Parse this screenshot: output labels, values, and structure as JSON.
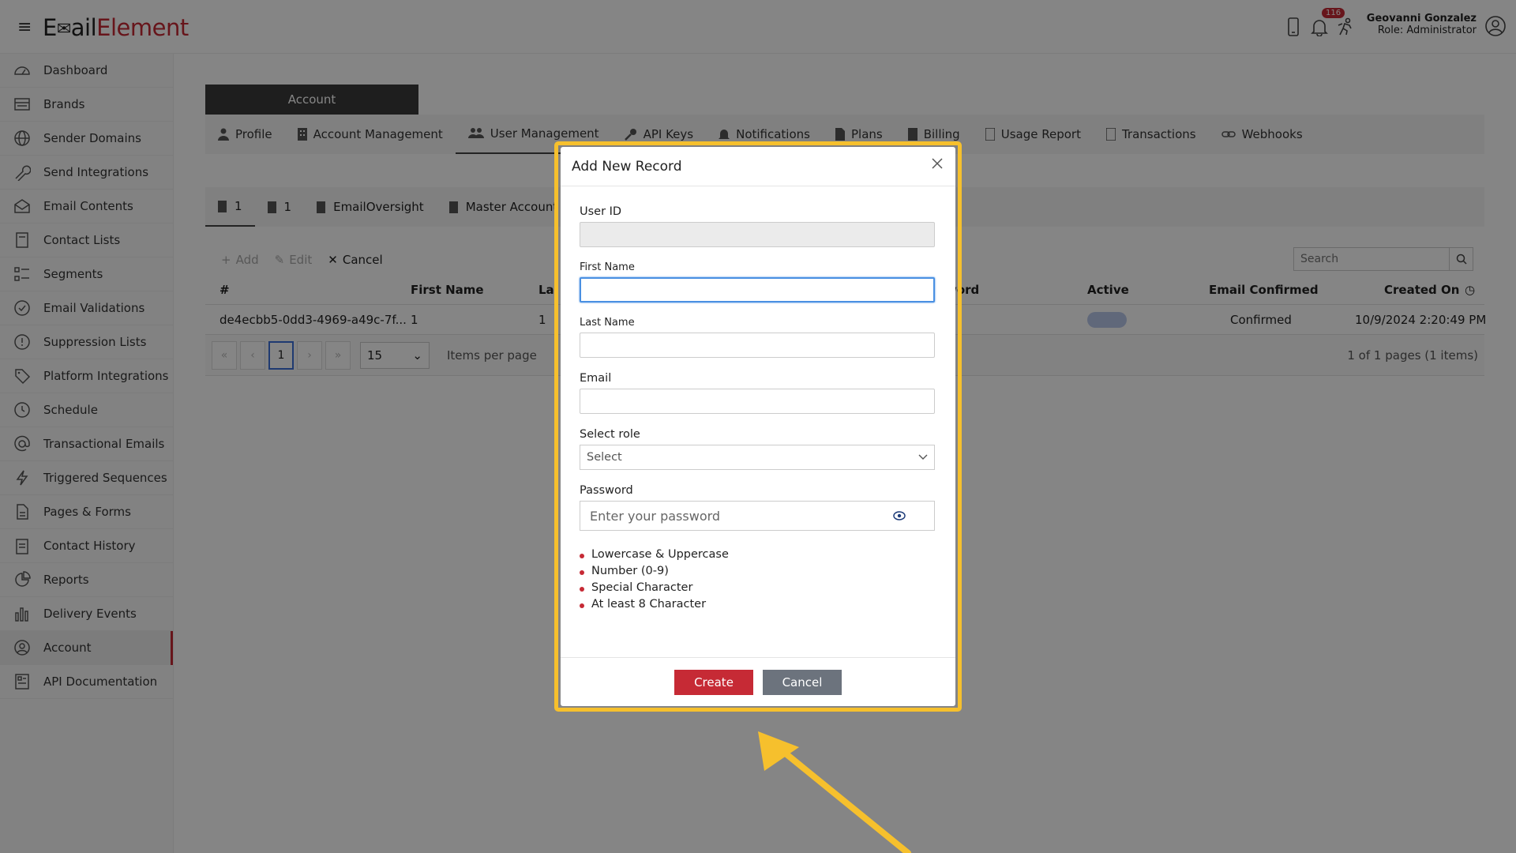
{
  "app": {
    "logo_prefix": "E",
    "logo_mid": "ail",
    "logo_suffix": "Element"
  },
  "header": {
    "notification_count": "116",
    "user_name": "Geovanni Gonzalez",
    "user_role": "Role: Administrator"
  },
  "sidebar": {
    "items": [
      {
        "label": "Dashboard",
        "icon": "dashboard-icon"
      },
      {
        "label": "Brands",
        "icon": "brands-icon"
      },
      {
        "label": "Sender Domains",
        "icon": "globe-icon"
      },
      {
        "label": "Send Integrations",
        "icon": "wrench-icon"
      },
      {
        "label": "Email Contents",
        "icon": "envelope-icon"
      },
      {
        "label": "Contact Lists",
        "icon": "book-icon"
      },
      {
        "label": "Segments",
        "icon": "segments-icon"
      },
      {
        "label": "Email Validations",
        "icon": "check-circle-icon"
      },
      {
        "label": "Suppression Lists",
        "icon": "exclamation-icon"
      },
      {
        "label": "Platform Integrations",
        "icon": "tag-icon"
      },
      {
        "label": "Schedule",
        "icon": "clock-icon"
      },
      {
        "label": "Transactional Emails",
        "icon": "at-icon"
      },
      {
        "label": "Triggered Sequences",
        "icon": "bolt-icon"
      },
      {
        "label": "Pages & Forms",
        "icon": "file-icon"
      },
      {
        "label": "Contact History",
        "icon": "clipboard-icon"
      },
      {
        "label": "Reports",
        "icon": "pie-chart-icon"
      },
      {
        "label": "Delivery Events",
        "icon": "bar-chart-icon"
      },
      {
        "label": "Account",
        "icon": "user-circle-icon"
      },
      {
        "label": "API Documentation",
        "icon": "api-doc-icon"
      }
    ],
    "active": "Account"
  },
  "main": {
    "account_tab": "Account",
    "tabs": [
      {
        "label": "Profile"
      },
      {
        "label": "Account Management"
      },
      {
        "label": "User Management"
      },
      {
        "label": "API Keys"
      },
      {
        "label": "Notifications"
      },
      {
        "label": "Plans"
      },
      {
        "label": "Billing"
      },
      {
        "label": "Usage Report"
      },
      {
        "label": "Transactions"
      },
      {
        "label": "Webhooks"
      }
    ],
    "subtabs": [
      {
        "label": "1"
      },
      {
        "label": "1"
      },
      {
        "label": "EmailOversight"
      },
      {
        "label": "Master Account"
      }
    ],
    "toolbar": {
      "add": "Add",
      "edit": "Edit",
      "cancel": "Cancel",
      "search_placeholder": "Search"
    },
    "grid": {
      "headers": {
        "id": "#",
        "first_name": "First Name",
        "last_name": "La",
        "password": "word",
        "active": "Active",
        "email_confirmed": "Email Confirmed",
        "created_on": "Created On"
      },
      "row": {
        "id": "de4ecbb5-0dd3-4969-a49c-7f...",
        "first_name": "1",
        "last_name": "1",
        "email_confirmed": "Confirmed",
        "created_on": "10/9/2024 2:20:49 PM"
      }
    },
    "pager": {
      "current_page": "1",
      "page_size": "15",
      "items_per_page": "Items per page",
      "summary": "1 of 1 pages (1 items)"
    }
  },
  "modal": {
    "title": "Add New Record",
    "user_id_label": "User ID",
    "user_id_value": "",
    "first_name_label": "First Name",
    "first_name_value": "",
    "last_name_label": "Last Name",
    "last_name_value": "",
    "email_label": "Email",
    "email_value": "",
    "role_label": "Select role",
    "role_value": "Select",
    "password_label": "Password",
    "password_placeholder": "Enter your password",
    "rules": [
      "Lowercase & Uppercase",
      "Number (0-9)",
      "Special Character",
      "At least 8 Character"
    ],
    "create_label": "Create",
    "cancel_label": "Cancel"
  },
  "colors": {
    "brand_red": "#c62a35",
    "highlight_yellow": "#f6c02d",
    "focus_blue": "#4a90e2"
  }
}
